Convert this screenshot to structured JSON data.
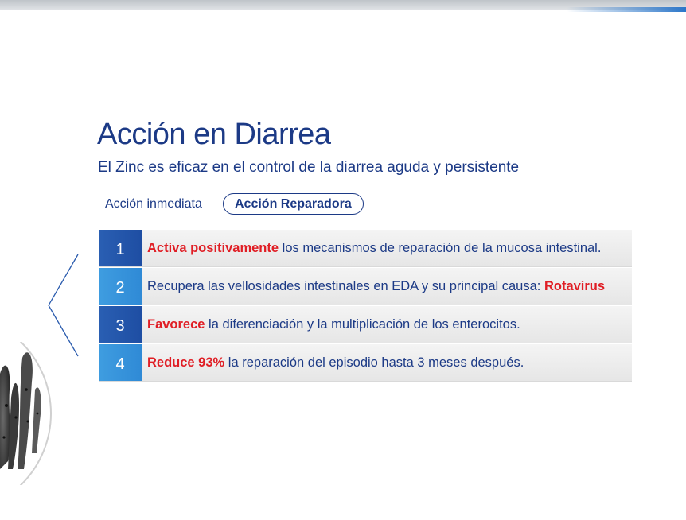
{
  "header": {
    "title": "Acción en Diarrea",
    "subtitle": "El Zinc es eficaz en el control de la diarrea aguda y persistente"
  },
  "tabs": [
    {
      "label": "Acción inmediata",
      "active": false
    },
    {
      "label": "Acción Reparadora",
      "active": true
    }
  ],
  "items": [
    {
      "number": "1",
      "highlight_before": "Activa positivamente",
      "text": " los mecanismos de reparación de la mucosa intestinal.",
      "highlight_after": ""
    },
    {
      "number": "2",
      "highlight_before": "",
      "text": "Recupera las vellosidades intestinales en EDA y su principal causa: ",
      "highlight_after": "Rotavirus"
    },
    {
      "number": "3",
      "highlight_before": "Favorece",
      "text": " la diferenciación y la multiplicación de los enterocitos.",
      "highlight_after": ""
    },
    {
      "number": "4",
      "highlight_before": "Reduce 93%",
      "text": " la reparación del episodio hasta 3 meses después.",
      "highlight_after": ""
    }
  ],
  "colors": {
    "primary": "#1c3a86",
    "highlight": "#e01e25",
    "badge_dark": "#2a5fb3",
    "badge_light": "#3f9de0"
  },
  "icons": {
    "nav": "chevron-left-icon",
    "image": "intestinal-villi-illustration"
  }
}
